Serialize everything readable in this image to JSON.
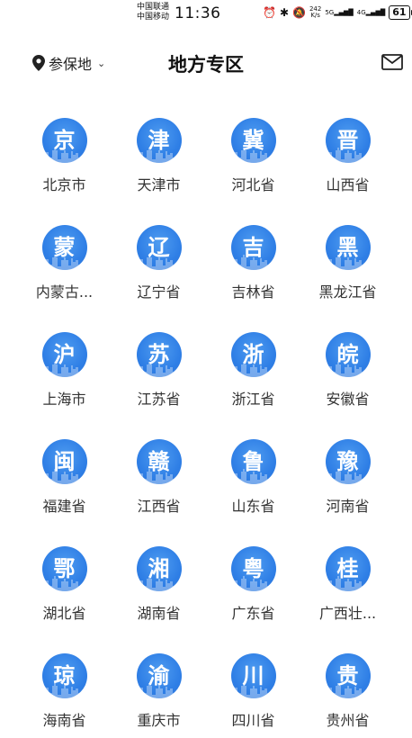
{
  "status_bar": {
    "carrier_1": "中国联通",
    "carrier_2": "中国移动",
    "time": "11:36",
    "net_speed_value": "242",
    "net_speed_unit": "K/s",
    "signal_1": "5G",
    "signal_2": "4G",
    "battery": "61"
  },
  "header": {
    "location_label": "参保地",
    "title": "地方专区"
  },
  "regions": [
    {
      "glyph": "京",
      "name": "北京市"
    },
    {
      "glyph": "津",
      "name": "天津市"
    },
    {
      "glyph": "冀",
      "name": "河北省"
    },
    {
      "glyph": "晋",
      "name": "山西省"
    },
    {
      "glyph": "蒙",
      "name": "内蒙古..."
    },
    {
      "glyph": "辽",
      "name": "辽宁省"
    },
    {
      "glyph": "吉",
      "name": "吉林省"
    },
    {
      "glyph": "黑",
      "name": "黑龙江省"
    },
    {
      "glyph": "沪",
      "name": "上海市"
    },
    {
      "glyph": "苏",
      "name": "江苏省"
    },
    {
      "glyph": "浙",
      "name": "浙江省"
    },
    {
      "glyph": "皖",
      "name": "安徽省"
    },
    {
      "glyph": "闽",
      "name": "福建省"
    },
    {
      "glyph": "赣",
      "name": "江西省"
    },
    {
      "glyph": "鲁",
      "name": "山东省"
    },
    {
      "glyph": "豫",
      "name": "河南省"
    },
    {
      "glyph": "鄂",
      "name": "湖北省"
    },
    {
      "glyph": "湘",
      "name": "湖南省"
    },
    {
      "glyph": "粤",
      "name": "广东省"
    },
    {
      "glyph": "桂",
      "name": "广西壮..."
    },
    {
      "glyph": "琼",
      "name": "海南省"
    },
    {
      "glyph": "渝",
      "name": "重庆市"
    },
    {
      "glyph": "川",
      "name": "四川省"
    },
    {
      "glyph": "贵",
      "name": "贵州省"
    }
  ],
  "colors": {
    "badge_blue": "#2f7fe6",
    "text": "#333333"
  },
  "icons": {
    "location": "location-pin-icon",
    "dropdown": "chevron-down-icon",
    "mail": "mail-icon"
  }
}
